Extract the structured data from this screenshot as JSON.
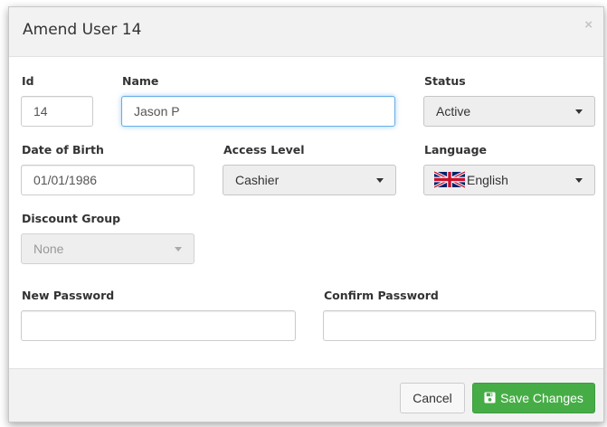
{
  "dialog": {
    "title": "Amend User 14",
    "close_glyph": "×"
  },
  "fields": {
    "id": {
      "label": "Id",
      "value": "14"
    },
    "name": {
      "label": "Name",
      "value": "Jason P"
    },
    "status": {
      "label": "Status",
      "value": "Active"
    },
    "dob": {
      "label": "Date of Birth",
      "value": "01/01/1986"
    },
    "access_level": {
      "label": "Access Level",
      "value": "Cashier"
    },
    "language": {
      "label": "Language",
      "value": "English",
      "icon": "uk-flag-icon"
    },
    "discount_group": {
      "label": "Discount Group",
      "value": "None",
      "disabled": true
    },
    "new_password": {
      "label": "New Password",
      "value": ""
    },
    "confirm_password": {
      "label": "Confirm Password",
      "value": ""
    }
  },
  "footer": {
    "cancel_label": "Cancel",
    "save_label": "Save Changes",
    "save_icon": "floppy-disk-icon"
  },
  "colors": {
    "save_button": "#46ad46",
    "focus_border": "#66afe9"
  }
}
